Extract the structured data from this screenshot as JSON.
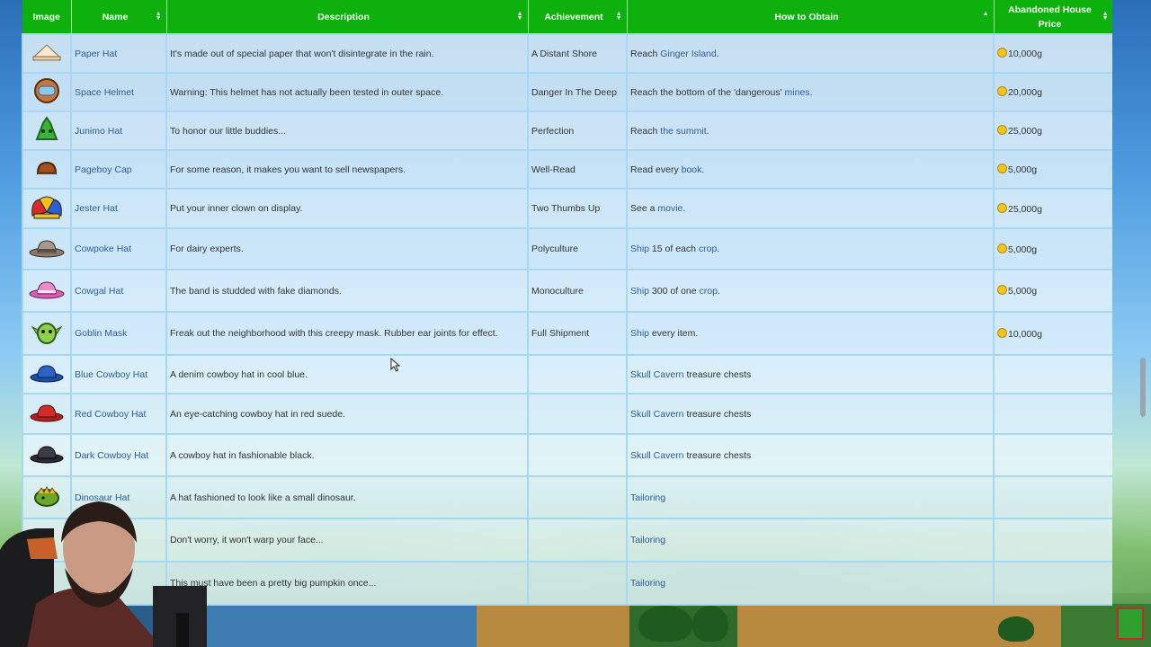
{
  "table": {
    "columns": [
      "Image",
      "Name",
      "Description",
      "Achievement",
      "How to Obtain",
      "Abandoned House Price"
    ],
    "rows": [
      {
        "icon": "paper-hat-icon",
        "name": "Paper Hat",
        "description": "It's made out of special paper that won't disintegrate in the rain.",
        "achievement": "A Distant Shore",
        "obtain_pre": "Reach ",
        "obtain_link": "Ginger Island",
        "obtain_post": ".",
        "price": "10,000g"
      },
      {
        "icon": "space-helmet-icon",
        "name": "Space Helmet",
        "description": "Warning: This helmet has not actually been tested in outer space.",
        "achievement": "Danger In The Deep",
        "obtain_pre": "Reach the bottom of the 'dangerous' ",
        "obtain_link": "mines",
        "obtain_post": ".",
        "price": "20,000g"
      },
      {
        "icon": "junimo-hat-icon",
        "name": "Junimo Hat",
        "description": "To honor our little buddies...",
        "achievement": "Perfection",
        "obtain_pre": "Reach ",
        "obtain_link": "the summit",
        "obtain_post": ".",
        "price": "25,000g"
      },
      {
        "icon": "pageboy-cap-icon",
        "name": "Pageboy Cap",
        "description": "For some reason, it makes you want to sell newspapers.",
        "achievement": "Well-Read",
        "obtain_pre": "Read every ",
        "obtain_link": "book",
        "obtain_post": ".",
        "price": "5,000g"
      },
      {
        "icon": "jester-hat-icon",
        "name": "Jester Hat",
        "description": "Put your inner clown on display.",
        "achievement": "Two Thumbs Up",
        "obtain_pre": "See a ",
        "obtain_link": "movie",
        "obtain_post": ".",
        "price": "25,000g"
      },
      {
        "icon": "cowpoke-hat-icon",
        "name": "Cowpoke Hat",
        "description": "For dairy experts.",
        "achievement": "Polyculture",
        "obtain_pre": "",
        "obtain_link": "Ship",
        "obtain_post": " 15 of each ",
        "obtain_link2": "crop",
        "obtain_post2": ".",
        "price": "5,000g"
      },
      {
        "icon": "cowgal-hat-icon",
        "name": "Cowgal Hat",
        "description": "The band is studded with fake diamonds.",
        "achievement": "Monoculture",
        "obtain_pre": "",
        "obtain_link": "Ship",
        "obtain_post": " 300 of one ",
        "obtain_link2": "crop",
        "obtain_post2": ".",
        "price": "5,000g"
      },
      {
        "icon": "goblin-mask-icon",
        "name": "Goblin Mask",
        "description": "Freak out the neighborhood with this creepy mask. Rubber ear joints for effect.",
        "achievement": "Full Shipment",
        "obtain_pre": "",
        "obtain_link": "Ship",
        "obtain_post": " every item.",
        "price": "10,000g"
      },
      {
        "icon": "blue-cowboy-hat-icon",
        "name": "Blue Cowboy Hat",
        "description": "A denim cowboy hat in cool blue.",
        "achievement": "",
        "obtain_pre": "",
        "obtain_link": "Skull Cavern",
        "obtain_post": " treasure chests",
        "price": ""
      },
      {
        "icon": "red-cowboy-hat-icon",
        "name": "Red Cowboy Hat",
        "description": "An eye-catching cowboy hat in red suede.",
        "achievement": "",
        "obtain_pre": "",
        "obtain_link": "Skull Cavern",
        "obtain_post": " treasure chests",
        "price": ""
      },
      {
        "icon": "dark-cowboy-hat-icon",
        "name": "Dark Cowboy Hat",
        "description": "A cowboy hat in fashionable black.",
        "achievement": "",
        "obtain_pre": "",
        "obtain_link": "Skull Cavern",
        "obtain_post": " treasure chests",
        "price": ""
      },
      {
        "icon": "dinosaur-hat-icon",
        "name": "Dinosaur Hat",
        "description": "A hat fashioned to look like a small dinosaur.",
        "achievement": "",
        "obtain_pre": "",
        "obtain_link": "Tailoring",
        "obtain_post": "",
        "price": ""
      },
      {
        "icon": "",
        "name": "",
        "description": "Don't worry, it won't warp your face...",
        "achievement": "",
        "obtain_pre": "",
        "obtain_link": "Tailoring",
        "obtain_post": "",
        "price": ""
      },
      {
        "icon": "",
        "name": "",
        "description": "This must have been a pretty big pumpkin once...",
        "achievement": "",
        "obtain_pre": "",
        "obtain_link": "Tailoring",
        "obtain_post": "",
        "price": ""
      }
    ]
  },
  "colors": {
    "header": "#0db00d",
    "link": "#2d5e9e",
    "coin": "#f0c419",
    "border": "#a8d7f3"
  }
}
